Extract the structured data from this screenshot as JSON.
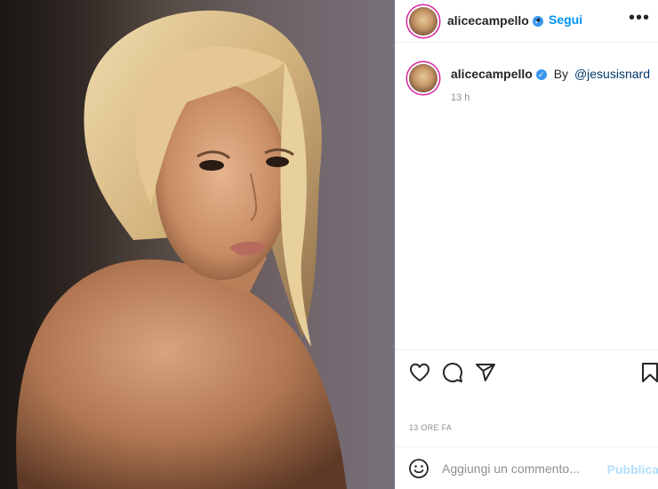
{
  "post": {
    "photo_icon": "portrait-photo",
    "header": {
      "username": "alicecampello",
      "verified_icon": "verified-badge-icon",
      "separator": "•",
      "follow_label": "Segui",
      "more_label": "•••"
    },
    "caption": {
      "username": "alicecampello",
      "by_text": "By",
      "mention": "@jesusisnard",
      "time": "13 h"
    },
    "actions": {
      "like_icon": "heart-icon",
      "comment_icon": "comment-bubble-icon",
      "share_icon": "paper-plane-icon",
      "save_icon": "bookmark-icon"
    },
    "posted_time": "13 ORE FA",
    "comment_box": {
      "emoji_icon": "smiley-icon",
      "placeholder": "Aggiungi un commento...",
      "publish_label": "Pubblica"
    }
  },
  "colors": {
    "link_blue": "#0095f6",
    "verified_blue": "#3897f0",
    "publish_disabled": "#b2dffc",
    "muted_text": "#8e8e8e",
    "mention_blue": "#00376b"
  }
}
